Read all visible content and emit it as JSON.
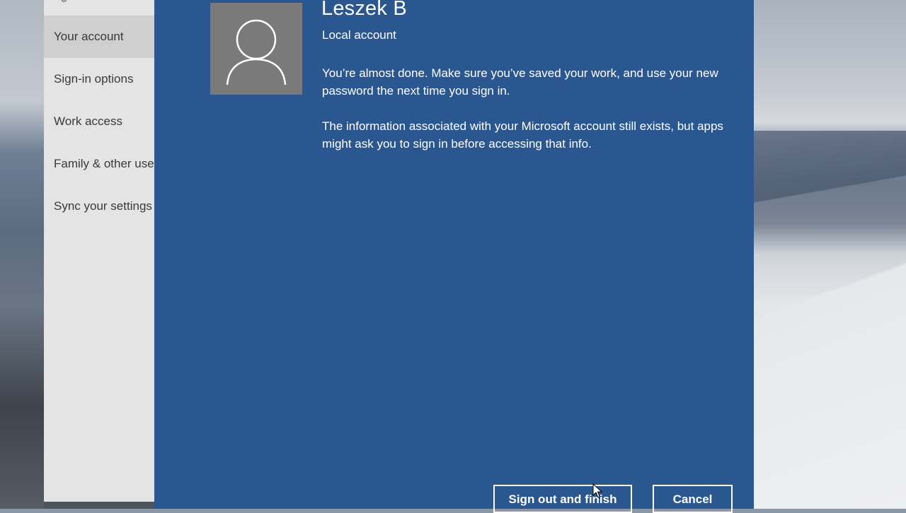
{
  "settings_nav": {
    "items": [
      {
        "label": "Your account",
        "selected": true
      },
      {
        "label": "Sign-in options",
        "selected": false
      },
      {
        "label": "Work access",
        "selected": false
      },
      {
        "label": "Family & other users",
        "selected": false
      },
      {
        "label": "Sync your settings",
        "selected": false
      }
    ]
  },
  "dialog": {
    "user_name": "Leszek B",
    "account_type": "Local account",
    "message_1": "You’re almost done. Make sure you’ve saved your work, and use your new password the next time you sign in.",
    "message_2": "The information associated with your Microsoft account still exists, but apps might ask you to sign in before accessing that info.",
    "primary_button": "Sign out and finish",
    "cancel_button": "Cancel",
    "avatar_icon": "user-silhouette-icon"
  },
  "colors": {
    "dialog_background": "#2b5790",
    "avatar_background": "#7a7a7a",
    "settings_background": "#e4e4e4",
    "selected_nav_background": "#cfcfcf"
  }
}
